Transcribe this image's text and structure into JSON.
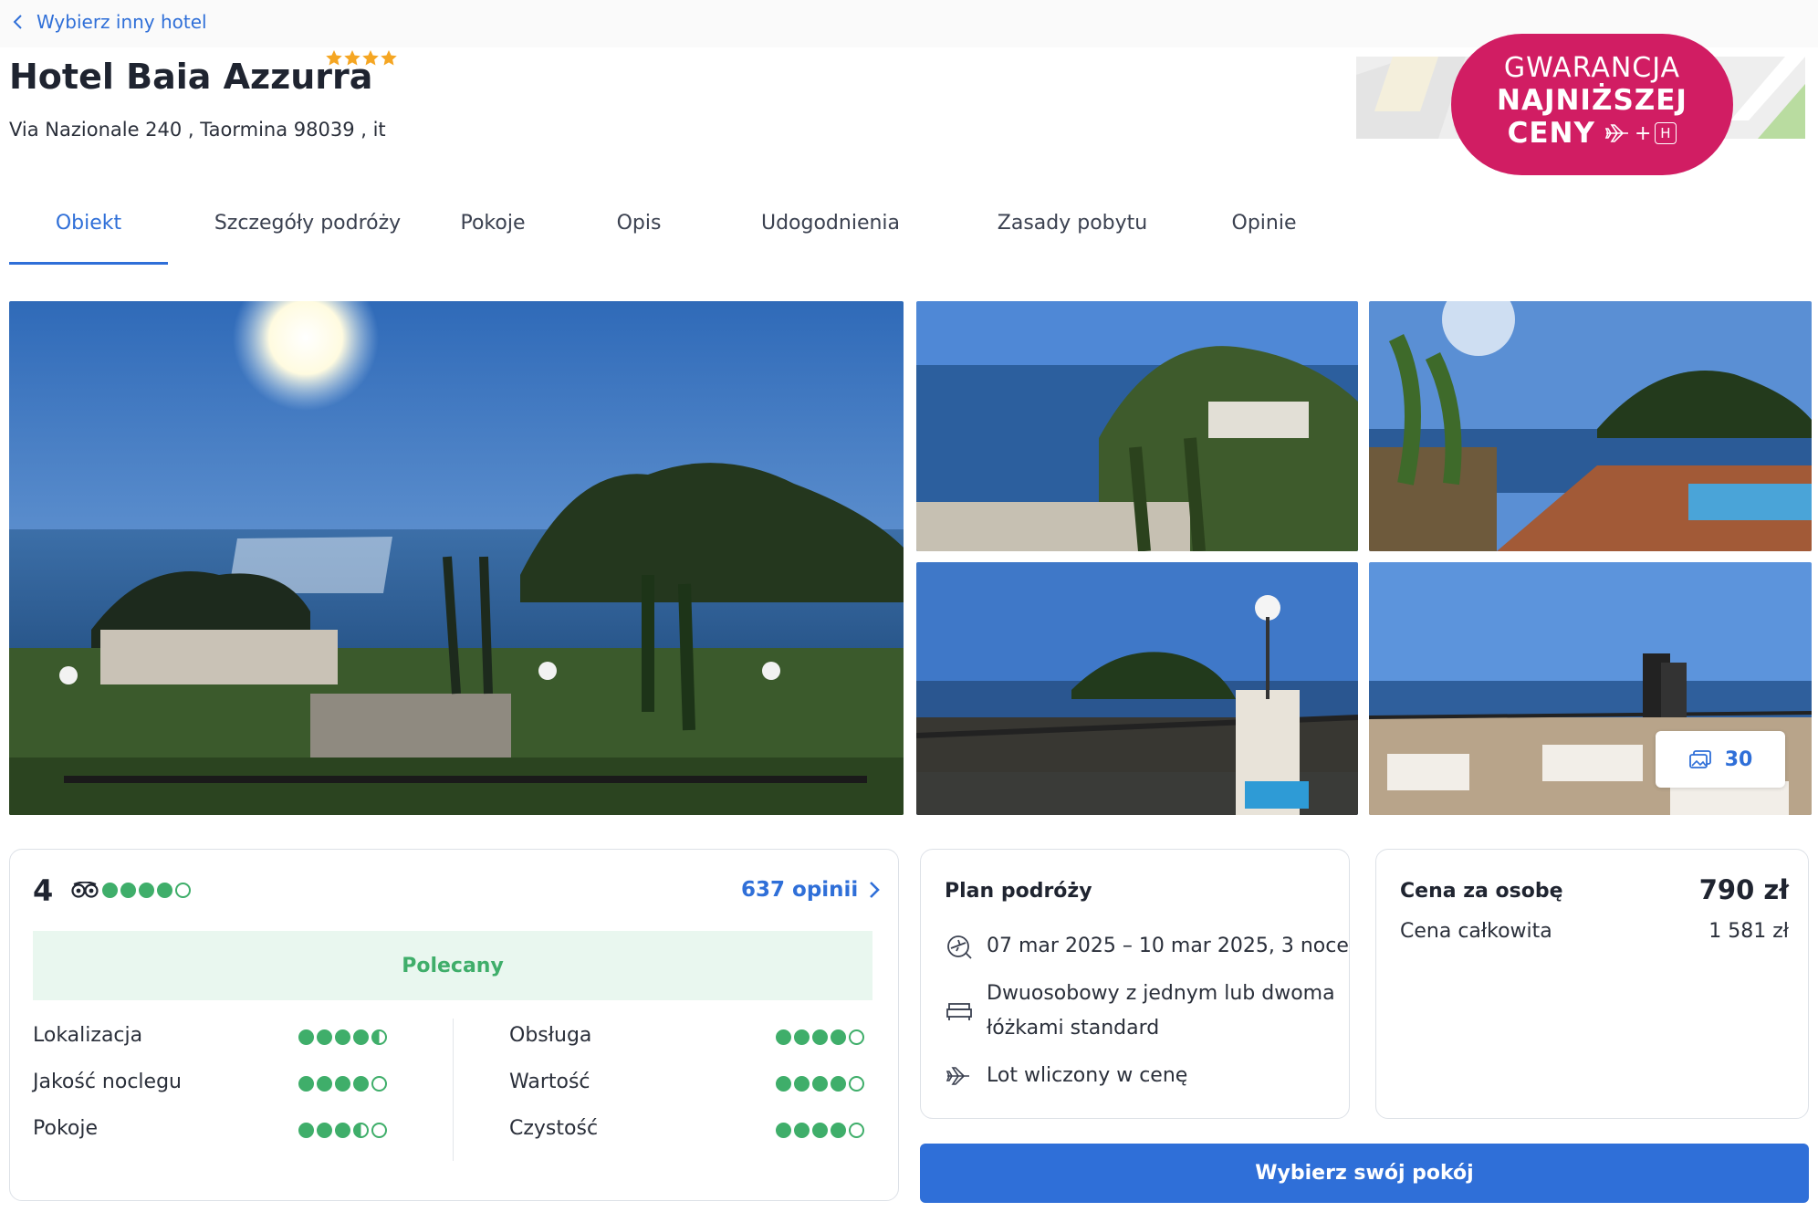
{
  "nav": {
    "back_label": "Wybierz inny hotel"
  },
  "hotel": {
    "name": "Hotel Baia Azzurra",
    "stars": 4,
    "address": "Via Nazionale 240 , Taormina 98039 , it"
  },
  "badge": {
    "line1": "GWARANCJA",
    "line2": "NAJNIŻSZEJ",
    "line3": "CENY",
    "plus": "+",
    "h_letter": "H",
    "color": "#d11d63"
  },
  "tabs": [
    {
      "label": "Obiekt",
      "active": true
    },
    {
      "label": "Szczegóły podróży",
      "active": false
    },
    {
      "label": "Pokoje",
      "active": false
    },
    {
      "label": "Opis",
      "active": false
    },
    {
      "label": "Udogodnienia",
      "active": false
    },
    {
      "label": "Zasady pobytu",
      "active": false
    },
    {
      "label": "Opinie",
      "active": false
    }
  ],
  "gallery": {
    "count": "30",
    "icon": "gallery-icon"
  },
  "rating": {
    "score": "4",
    "overall_dots": 4,
    "opinions_label": "637 opinii",
    "recommended": "Polecany",
    "criteria_left": [
      {
        "label": "Lokalizacja",
        "value": 4.5
      },
      {
        "label": "Jakość noclegu",
        "value": 4
      },
      {
        "label": "Pokoje",
        "value": 3.5
      }
    ],
    "criteria_right": [
      {
        "label": "Obsługa",
        "value": 4
      },
      {
        "label": "Wartość",
        "value": 4
      },
      {
        "label": "Czystość",
        "value": 4
      }
    ]
  },
  "plan": {
    "title": "Plan podróży",
    "dates": "07 mar 2025 – 10 mar 2025, 3 noce",
    "room_line1": "Dwuosobowy z jednym lub dwoma",
    "room_line2": "łóżkami standard",
    "flight": "Lot wliczony w cenę"
  },
  "price": {
    "per_person_label": "Cena za osobę",
    "per_person_value": "790 zł",
    "total_label": "Cena całkowita",
    "total_value": "1 581 zł"
  },
  "cta": {
    "label": "Wybierz swój pokój"
  },
  "colors": {
    "accent": "#2f6fd8",
    "green": "#3fae6a",
    "text": "#1f2430"
  }
}
